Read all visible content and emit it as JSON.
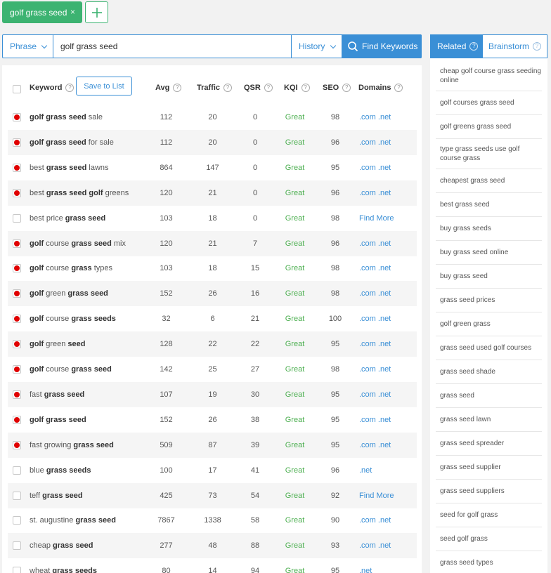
{
  "tab": {
    "label": "golf grass seed",
    "close": "×"
  },
  "search": {
    "mode": "Phrase",
    "value": "golf grass seed",
    "history": "History",
    "find": "Find Keywords"
  },
  "table": {
    "headers": {
      "keyword": "Keyword",
      "save": "Save to List",
      "avg": "Avg",
      "traffic": "Traffic",
      "qsr": "QSR",
      "kqi": "KQI",
      "seo": "SEO",
      "domains": "Domains"
    },
    "rows": [
      {
        "checked": true,
        "kw": [
          [
            "golf grass seed",
            true
          ],
          [
            " sale",
            false
          ]
        ],
        "avg": "112",
        "traffic": "20",
        "qsr": "0",
        "kqi": "Great",
        "seo": "98",
        "domains": ".com .net"
      },
      {
        "checked": true,
        "kw": [
          [
            "golf grass seed",
            true
          ],
          [
            " for sale",
            false
          ]
        ],
        "avg": "112",
        "traffic": "20",
        "qsr": "0",
        "kqi": "Great",
        "seo": "96",
        "domains": ".com .net"
      },
      {
        "checked": true,
        "kw": [
          [
            "best ",
            false
          ],
          [
            "grass seed",
            true
          ],
          [
            " lawns",
            false
          ]
        ],
        "avg": "864",
        "traffic": "147",
        "qsr": "0",
        "kqi": "Great",
        "seo": "95",
        "domains": ".com .net"
      },
      {
        "checked": true,
        "kw": [
          [
            "best ",
            false
          ],
          [
            "grass seed golf",
            true
          ],
          [
            " greens",
            false
          ]
        ],
        "avg": "120",
        "traffic": "21",
        "qsr": "0",
        "kqi": "Great",
        "seo": "96",
        "domains": ".com .net"
      },
      {
        "checked": false,
        "kw": [
          [
            "best price ",
            false
          ],
          [
            "grass seed",
            true
          ]
        ],
        "avg": "103",
        "traffic": "18",
        "qsr": "0",
        "kqi": "Great",
        "seo": "98",
        "domains": "Find More"
      },
      {
        "checked": true,
        "kw": [
          [
            "golf",
            true
          ],
          [
            " course ",
            false
          ],
          [
            "grass seed",
            true
          ],
          [
            " mix",
            false
          ]
        ],
        "avg": "120",
        "traffic": "21",
        "qsr": "7",
        "kqi": "Great",
        "seo": "96",
        "domains": ".com .net"
      },
      {
        "checked": true,
        "kw": [
          [
            "golf",
            true
          ],
          [
            " course ",
            false
          ],
          [
            "grass",
            true
          ],
          [
            " types",
            false
          ]
        ],
        "avg": "103",
        "traffic": "18",
        "qsr": "15",
        "kqi": "Great",
        "seo": "98",
        "domains": ".com .net"
      },
      {
        "checked": true,
        "kw": [
          [
            "golf",
            true
          ],
          [
            " green ",
            false
          ],
          [
            "grass seed",
            true
          ]
        ],
        "avg": "152",
        "traffic": "26",
        "qsr": "16",
        "kqi": "Great",
        "seo": "98",
        "domains": ".com .net"
      },
      {
        "checked": true,
        "kw": [
          [
            "golf",
            true
          ],
          [
            " course ",
            false
          ],
          [
            "grass seeds",
            true
          ]
        ],
        "avg": "32",
        "traffic": "6",
        "qsr": "21",
        "kqi": "Great",
        "seo": "100",
        "domains": ".com .net"
      },
      {
        "checked": true,
        "kw": [
          [
            "golf",
            true
          ],
          [
            " green ",
            false
          ],
          [
            "seed",
            true
          ]
        ],
        "avg": "128",
        "traffic": "22",
        "qsr": "22",
        "kqi": "Great",
        "seo": "95",
        "domains": ".com .net"
      },
      {
        "checked": true,
        "kw": [
          [
            "golf",
            true
          ],
          [
            " course ",
            false
          ],
          [
            "grass seed",
            true
          ]
        ],
        "avg": "142",
        "traffic": "25",
        "qsr": "27",
        "kqi": "Great",
        "seo": "98",
        "domains": ".com .net"
      },
      {
        "checked": true,
        "kw": [
          [
            "fast ",
            false
          ],
          [
            "grass seed",
            true
          ]
        ],
        "avg": "107",
        "traffic": "19",
        "qsr": "30",
        "kqi": "Great",
        "seo": "95",
        "domains": ".com .net"
      },
      {
        "checked": true,
        "kw": [
          [
            "golf grass seed",
            true
          ]
        ],
        "avg": "152",
        "traffic": "26",
        "qsr": "38",
        "kqi": "Great",
        "seo": "95",
        "domains": ".com .net"
      },
      {
        "checked": true,
        "kw": [
          [
            "fast growing ",
            false
          ],
          [
            "grass seed",
            true
          ]
        ],
        "avg": "509",
        "traffic": "87",
        "qsr": "39",
        "kqi": "Great",
        "seo": "95",
        "domains": ".com .net"
      },
      {
        "checked": false,
        "kw": [
          [
            "blue ",
            false
          ],
          [
            "grass seeds",
            true
          ]
        ],
        "avg": "100",
        "traffic": "17",
        "qsr": "41",
        "kqi": "Great",
        "seo": "96",
        "domains": ".net"
      },
      {
        "checked": false,
        "kw": [
          [
            "teff ",
            false
          ],
          [
            "grass seed",
            true
          ]
        ],
        "avg": "425",
        "traffic": "73",
        "qsr": "54",
        "kqi": "Great",
        "seo": "92",
        "domains": "Find More"
      },
      {
        "checked": false,
        "kw": [
          [
            "st. augustine ",
            false
          ],
          [
            "grass seed",
            true
          ]
        ],
        "avg": "7867",
        "traffic": "1338",
        "qsr": "58",
        "kqi": "Great",
        "seo": "90",
        "domains": ".com .net"
      },
      {
        "checked": false,
        "kw": [
          [
            "cheap ",
            false
          ],
          [
            "grass seed",
            true
          ]
        ],
        "avg": "277",
        "traffic": "48",
        "qsr": "88",
        "kqi": "Great",
        "seo": "93",
        "domains": ".com .net"
      },
      {
        "checked": false,
        "kw": [
          [
            "wheat ",
            false
          ],
          [
            "grass seeds",
            true
          ]
        ],
        "avg": "80",
        "traffic": "14",
        "qsr": "94",
        "kqi": "Great",
        "seo": "95",
        "domains": ".net"
      }
    ]
  },
  "side": {
    "tabs": {
      "related": "Related",
      "brainstorm": "Brainstorm"
    },
    "items": [
      "cheap golf course grass seeding online",
      "golf courses grass seed",
      "golf greens grass seed",
      "type grass seeds use golf course grass",
      "cheapest grass seed",
      "best grass seed",
      "buy grass seeds",
      "buy grass seed online",
      "buy grass seed",
      "grass seed prices",
      "golf green grass",
      "grass seed used golf courses",
      "grass seed shade",
      "grass seed",
      "grass seed lawn",
      "grass seed spreader",
      "grass seed supplier",
      "grass seed suppliers",
      "seed for golf grass",
      "seed golf grass",
      "grass seed types"
    ]
  },
  "colors": {
    "green": "#3cb371",
    "blue": "#3a8fd6",
    "red": "#e00000",
    "kqi_green": "#4caf50"
  },
  "icons": {
    "add": "plus-icon",
    "search": "magnifier-icon",
    "help": "question-circle-icon"
  }
}
